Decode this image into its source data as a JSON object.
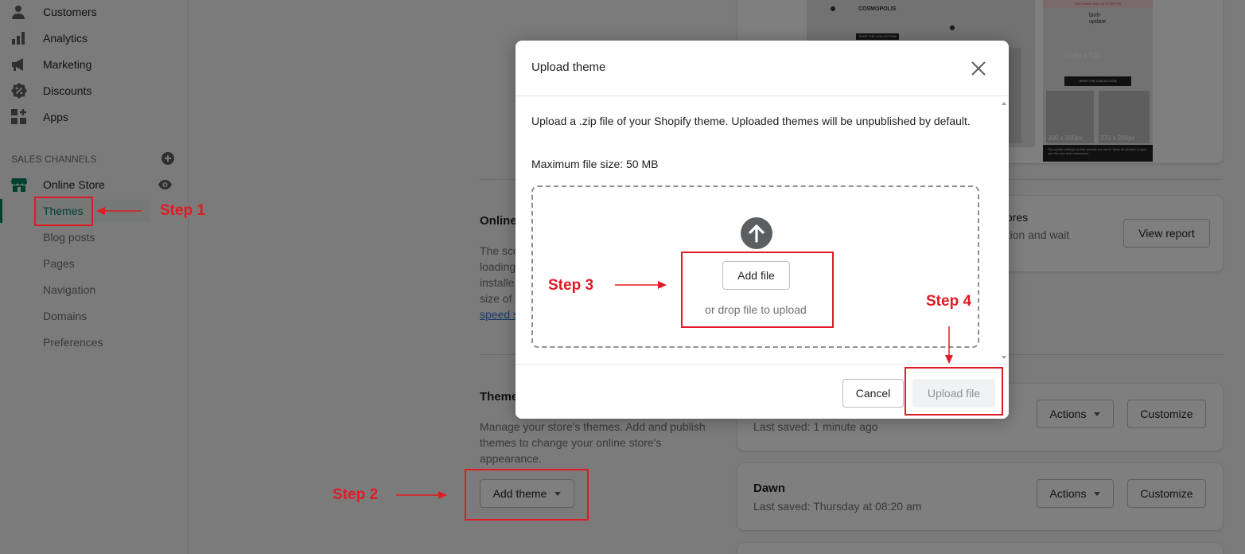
{
  "sidebar": {
    "nav": [
      {
        "label": "Customers",
        "icon": "person-icon"
      },
      {
        "label": "Analytics",
        "icon": "bar-chart-icon"
      },
      {
        "label": "Marketing",
        "icon": "megaphone-icon"
      },
      {
        "label": "Discounts",
        "icon": "discount-badge-icon"
      },
      {
        "label": "Apps",
        "icon": "apps-grid-icon"
      }
    ],
    "sales_channels_label": "SALES CHANNELS",
    "online_store_label": "Online Store",
    "sub_items": [
      "Themes",
      "Blog posts",
      "Pages",
      "Navigation",
      "Domains",
      "Preferences"
    ]
  },
  "main": {
    "online_title": "Online",
    "online_desc": [
      "The sco",
      "loading",
      "installe",
      "size of",
      "speed s"
    ],
    "speed_card": {
      "line1": "l stores",
      "line2": "tection and wait",
      "button": "View report"
    },
    "themes_title": "Theme",
    "themes_desc": [
      "Manage your store's themes. Add and publish",
      "themes to change your online store's",
      "appearance."
    ],
    "add_theme_button": "Add theme",
    "themes": [
      {
        "name": "",
        "saved": "Last saved: 1 minute ago",
        "actions": "Actions",
        "customize": "Customize"
      },
      {
        "name": "Dawn",
        "saved": "Last saved: Thursday at 08:20 am",
        "actions": "Actions",
        "customize": "Customize"
      }
    ],
    "preview": {
      "brand": "COSMOPOLIS",
      "desktop_cta": "SHOP THE COLLECTION",
      "mobile_banner": "Mid-Season Sale Up To 70% Off",
      "mobile_store": "binh-update",
      "mobile_dim": "1080 x 720",
      "mobile_cta": "SHOP THE COLLECTION",
      "mobile_tile_1": "390 x 200px",
      "mobile_tile_2": "370 x 200px",
      "cookie_text": "The cookie settings on this website are set to 'allow all cookies' to give you the very best experience."
    }
  },
  "modal": {
    "title": "Upload theme",
    "description": "Upload a .zip file of your Shopify theme. Uploaded themes will be unpublished by default.",
    "max_size": "Maximum file size: 50 MB",
    "add_file_button": "Add file",
    "drop_text": "or drop file to upload",
    "cancel_button": "Cancel",
    "upload_button": "Upload file"
  },
  "annotations": {
    "step1": "Step 1",
    "step2": "Step 2",
    "step3": "Step 3",
    "step4": "Step 4",
    "color": "#e01b24"
  }
}
